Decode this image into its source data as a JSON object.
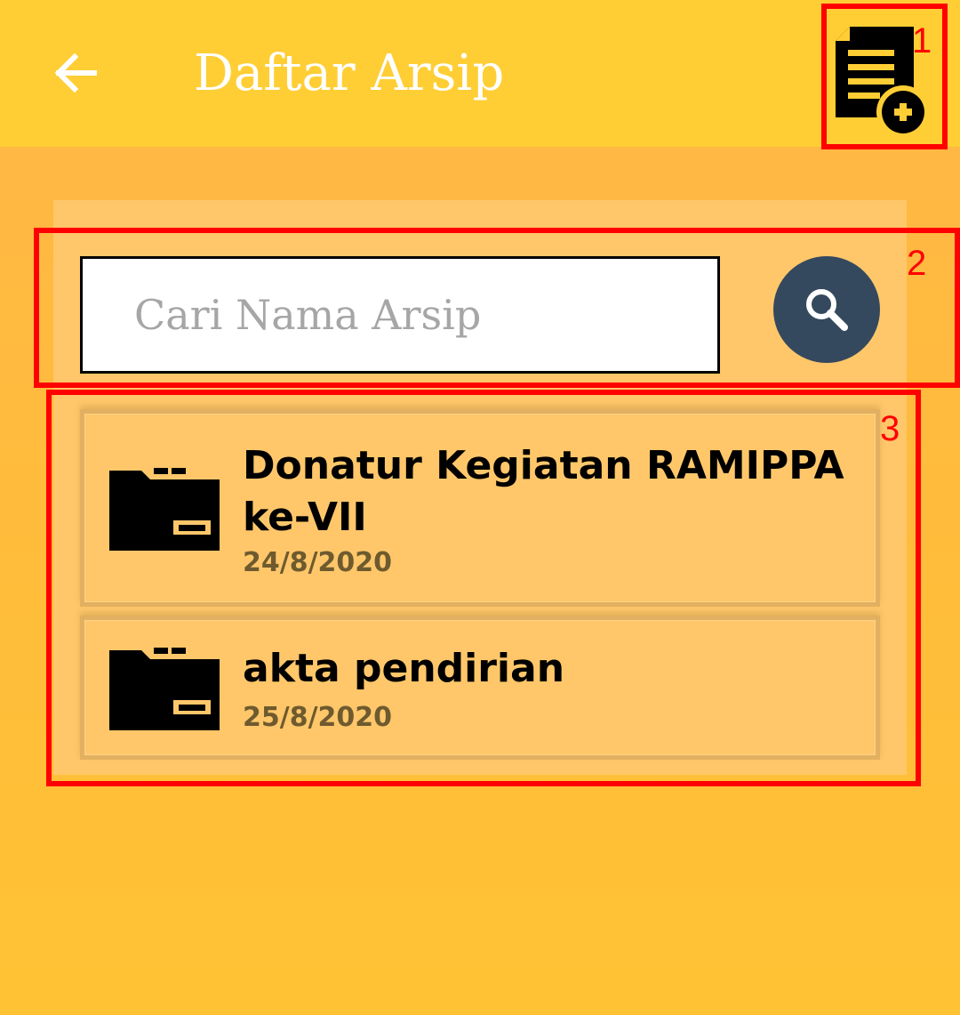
{
  "header": {
    "title": "Daftar Arsip",
    "back_icon": "arrow-left-icon",
    "add_icon": "add-document-icon"
  },
  "search": {
    "placeholder": "Cari Nama Arsip",
    "value": "",
    "button_icon": "search-icon"
  },
  "archives": [
    {
      "title": "Donatur Kegiatan RAMIPPA ke-VII",
      "date": "24/8/2020",
      "icon": "folder-icon"
    },
    {
      "title": "akta pendirian",
      "date": "25/8/2020",
      "icon": "folder-icon"
    }
  ],
  "annotations": [
    "1",
    "2",
    "3"
  ],
  "colors": {
    "appbar": "#FFCE35",
    "background": "#FFBE3C",
    "panel": "#FFC76A",
    "search_button": "#34495E",
    "annotation": "#FF0000"
  }
}
